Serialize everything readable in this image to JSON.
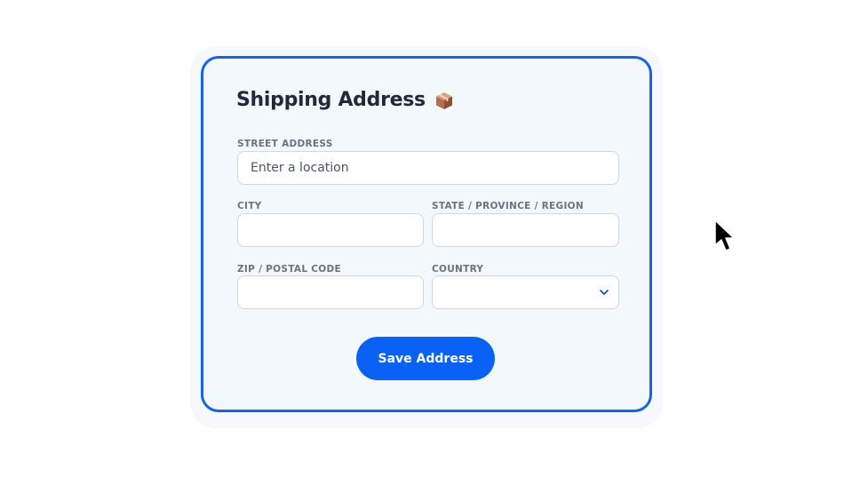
{
  "form": {
    "title": "Shipping Address",
    "title_icon": "package-icon",
    "street": {
      "label": "STREET ADDRESS",
      "placeholder": "Enter a location",
      "value": ""
    },
    "city": {
      "label": "CITY",
      "value": ""
    },
    "state": {
      "label": "STATE / PROVINCE / REGION",
      "value": ""
    },
    "zip": {
      "label": "ZIP / POSTAL CODE",
      "value": ""
    },
    "country": {
      "label": "COUNTRY",
      "selected": ""
    },
    "save_label": "Save Address"
  },
  "colors": {
    "accent": "#0a62f5",
    "card_border": "#1565e0",
    "card_background": "#f3f8fd",
    "title_text": "#1e293b",
    "label_text": "#6b7280"
  }
}
